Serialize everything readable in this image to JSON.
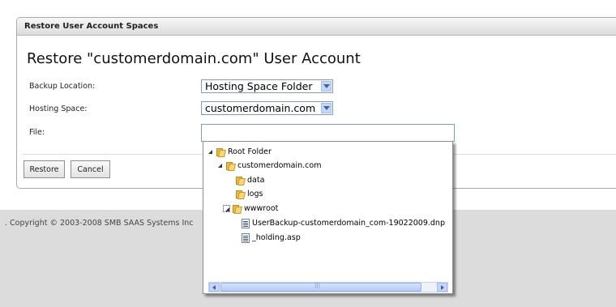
{
  "panel": {
    "header": "Restore User Account Spaces"
  },
  "page_title": "Restore \"customerdomain.com\" User Account",
  "form": {
    "backup_location_label": "Backup Location:",
    "backup_location_value": "Hosting Space Folder",
    "hosting_space_label": "Hosting Space:",
    "hosting_space_value": "customerdomain.com",
    "file_label": "File:",
    "file_value": ""
  },
  "buttons": {
    "restore": "Restore",
    "cancel": "Cancel"
  },
  "tree": [
    {
      "label": "Root Folder",
      "type": "folder",
      "expanded": true
    },
    {
      "label": "customerdomain.com",
      "type": "folder",
      "expanded": true
    },
    {
      "label": "data",
      "type": "folder"
    },
    {
      "label": "logs",
      "type": "folder"
    },
    {
      "label": "wwwroot",
      "type": "folder",
      "expanded": true,
      "focused": true
    },
    {
      "label": "UserBackup-customerdomain_com-19022009.dnp",
      "type": "file"
    },
    {
      "label": "_holding.asp",
      "type": "file"
    }
  ],
  "footer": {
    "copyright": ". Copyright © 2003-2008 SMB SAAS Systems Inc"
  }
}
